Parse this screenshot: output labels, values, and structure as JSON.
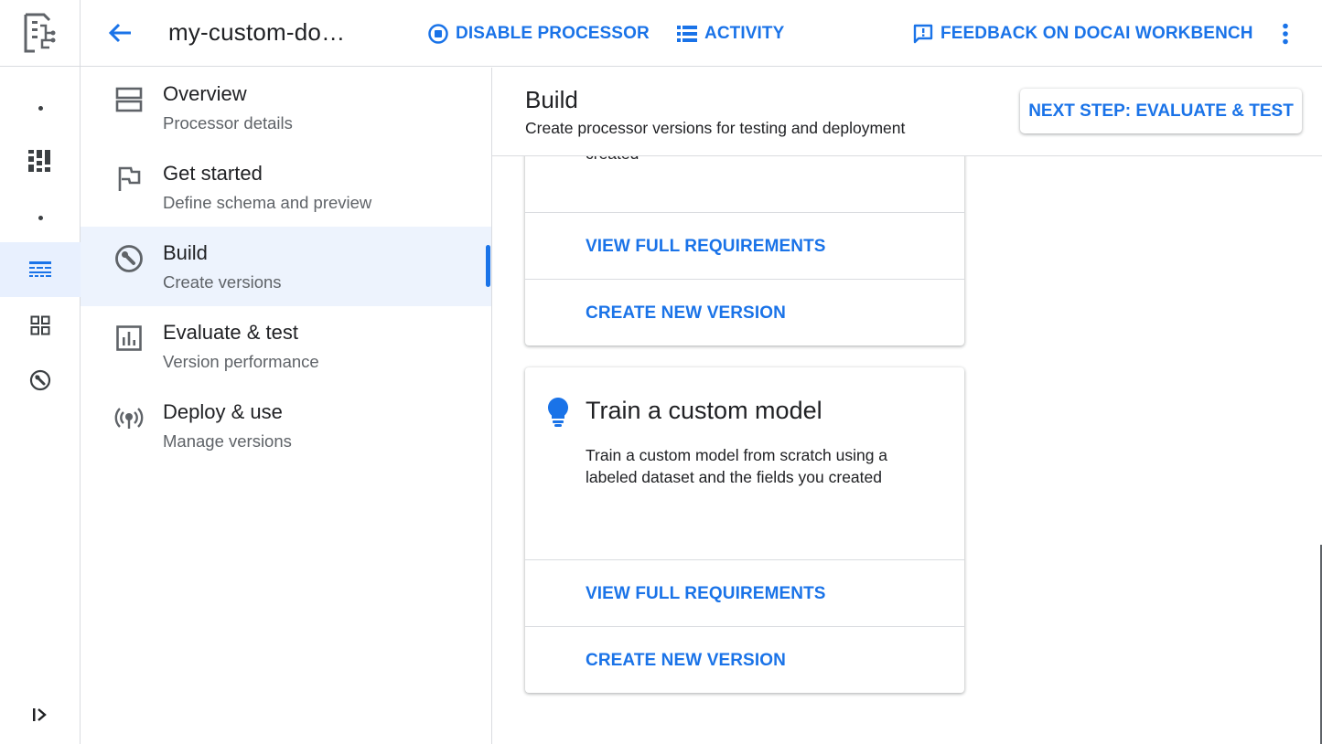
{
  "rail": {
    "icons": [
      "document-ai-logo-icon",
      "dot-icon",
      "dashboard-icon",
      "dot-icon",
      "processors-icon",
      "apps-grid-icon",
      "build-wrench-icon",
      "expand-icon"
    ]
  },
  "header": {
    "title": "my-custom-do…",
    "disable_label": "DISABLE PROCESSOR",
    "activity_label": "ACTIVITY",
    "feedback_label": "FEEDBACK ON DOCAI WORKBENCH"
  },
  "subnav": {
    "items": [
      {
        "title": "Overview",
        "subtitle": "Processor details"
      },
      {
        "title": "Get started",
        "subtitle": "Define schema and preview"
      },
      {
        "title": "Build",
        "subtitle": "Create versions"
      },
      {
        "title": "Evaluate & test",
        "subtitle": "Version performance"
      },
      {
        "title": "Deploy & use",
        "subtitle": "Manage versions"
      }
    ],
    "active_index": 2
  },
  "main": {
    "title": "Build",
    "subtitle": "Create processor versions for testing and deployment",
    "next_label": "NEXT STEP: EVALUATE & TEST",
    "cards": [
      {
        "fragment": "created",
        "view_label": "VIEW FULL REQUIREMENTS",
        "create_label": "CREATE NEW VERSION"
      },
      {
        "title": "Train a custom model",
        "description": "Train a custom model from scratch using a labeled dataset and the fields you created",
        "view_label": "VIEW FULL REQUIREMENTS",
        "create_label": "CREATE NEW VERSION"
      }
    ]
  },
  "colors": {
    "accent": "#1a73e8",
    "active_bg": "#e8f0fe",
    "border": "#dadce0",
    "secondary_text": "#5f6368"
  }
}
